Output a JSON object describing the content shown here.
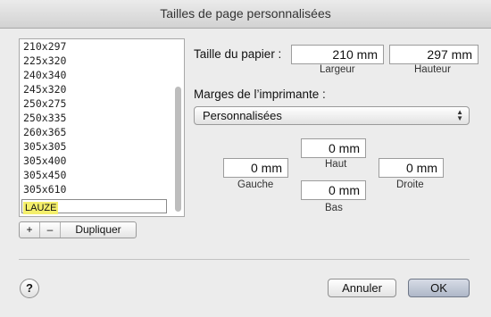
{
  "window": {
    "title": "Tailles de page personnalisées"
  },
  "sizes": {
    "items": [
      "210x297",
      "225x320",
      "240x340",
      "245x320",
      "250x275",
      "250x335",
      "260x365",
      "305x305",
      "305x400",
      "305x450",
      "305x610"
    ],
    "editing_value": "LAUZE"
  },
  "toolbar": {
    "add": "+",
    "remove": "–",
    "duplicate": "Dupliquer"
  },
  "paper": {
    "label": "Taille du papier :",
    "width_value": "210 mm",
    "width_label": "Largeur",
    "height_value": "297 mm",
    "height_label": "Hauteur"
  },
  "margins": {
    "label": "Marges de l’imprimante :",
    "popup_value": "Personnalisées",
    "top_value": "0 mm",
    "top_label": "Haut",
    "left_value": "0 mm",
    "left_label": "Gauche",
    "right_value": "0 mm",
    "right_label": "Droite",
    "bottom_value": "0 mm",
    "bottom_label": "Bas"
  },
  "footer": {
    "help": "?",
    "cancel": "Annuler",
    "ok": "OK"
  }
}
